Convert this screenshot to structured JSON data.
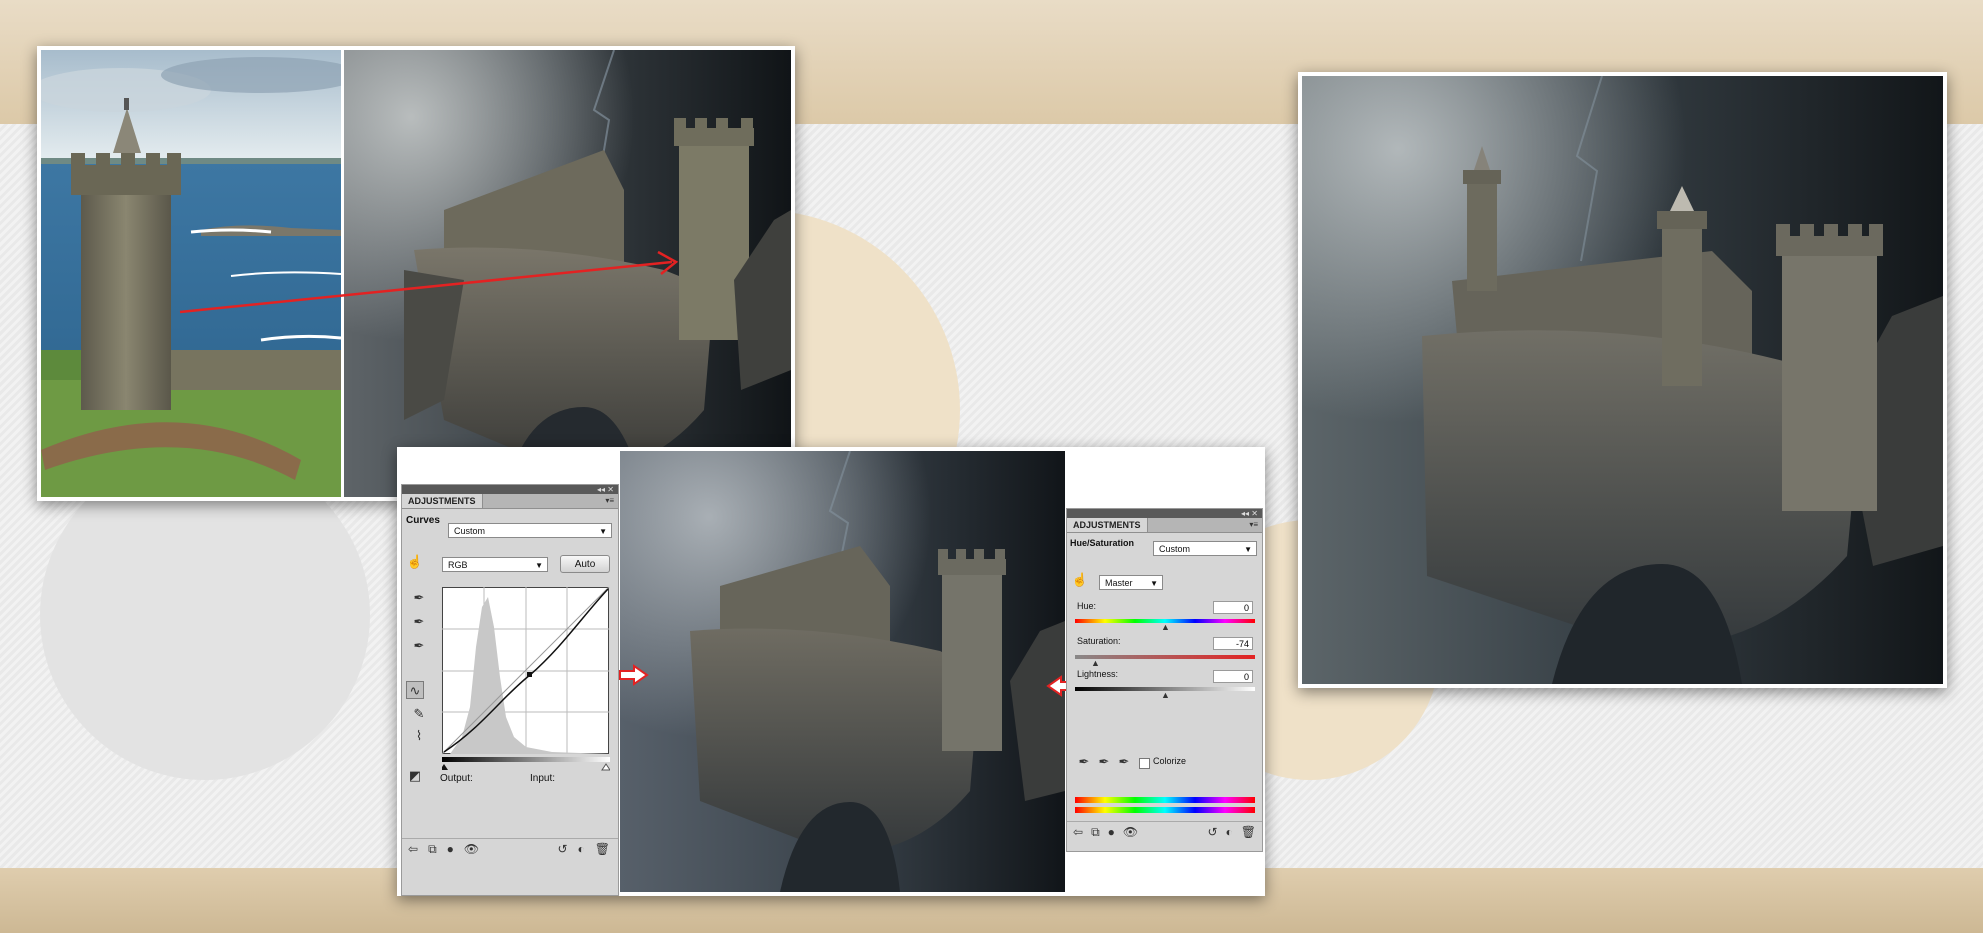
{
  "curves_panel": {
    "tab": "ADJUSTMENTS",
    "title": "Curves",
    "preset": "Custom",
    "channel": "RGB",
    "auto_label": "Auto",
    "output_label": "Output:",
    "input_label": "Input:"
  },
  "huesat_panel": {
    "tab": "ADJUSTMENTS",
    "title": "Hue/Saturation",
    "preset": "Custom",
    "channel": "Master",
    "hue_label": "Hue:",
    "hue_value": "0",
    "saturation_label": "Saturation:",
    "saturation_value": "-74",
    "lightness_label": "Lightness:",
    "lightness_value": "0",
    "colorize_label": "Colorize"
  },
  "colors": {
    "arrow_red": "#e32222",
    "panel_gray": "#d6d6d6",
    "band_tan": "#dcc9a8"
  }
}
